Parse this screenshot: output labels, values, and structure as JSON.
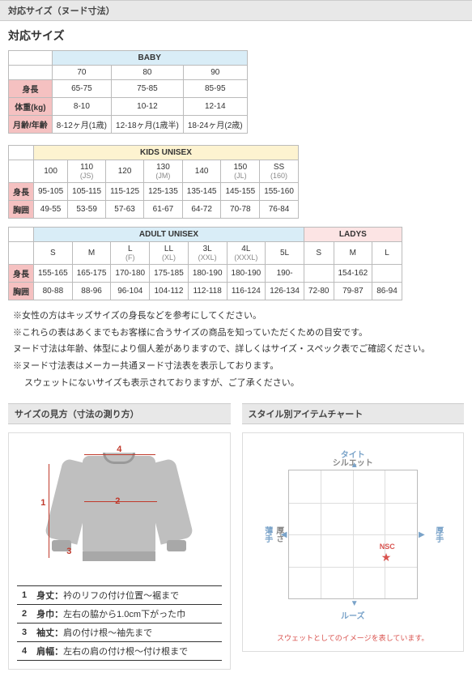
{
  "header": {
    "title": "対応サイズ（ヌード寸法）"
  },
  "main_heading": "対応サイズ",
  "baby": {
    "group": "BABY",
    "sizes": [
      "70",
      "80",
      "90"
    ],
    "rows": {
      "height_label": "身長",
      "height": [
        "65-75",
        "75-85",
        "85-95"
      ],
      "weight_label": "体重(kg)",
      "weight": [
        "8-10",
        "10-12",
        "12-14"
      ],
      "months_label": "月齢/年齢",
      "months": [
        "8-12ヶ月(1歳)",
        "12-18ヶ月(1歳半)",
        "18-24ヶ月(2歳)"
      ]
    }
  },
  "kids": {
    "group": "KIDS UNISEX",
    "sizes": [
      "100",
      "110",
      "120",
      "130",
      "140",
      "150",
      "SS"
    ],
    "subs": [
      "",
      "(JS)",
      "",
      "(JM)",
      "",
      "(JL)",
      "(160)"
    ],
    "rows": {
      "height_label": "身長",
      "height": [
        "95-105",
        "105-115",
        "115-125",
        "125-135",
        "135-145",
        "145-155",
        "155-160"
      ],
      "chest_label": "胸囲",
      "chest": [
        "49-55",
        "53-59",
        "57-63",
        "61-67",
        "64-72",
        "70-78",
        "76-84"
      ]
    }
  },
  "adult": {
    "group": "ADULT UNISEX",
    "sizes": [
      "S",
      "M",
      "L",
      "LL",
      "3L",
      "4L",
      "5L"
    ],
    "subs": [
      "",
      "",
      "(F)",
      "(XL)",
      "(XXL)",
      "(XXXL)",
      ""
    ],
    "rows": {
      "height_label": "身長",
      "height": [
        "155-165",
        "165-175",
        "170-180",
        "175-185",
        "180-190",
        "180-190",
        "190-"
      ],
      "chest_label": "胸囲",
      "chest": [
        "80-88",
        "88-96",
        "96-104",
        "104-112",
        "112-118",
        "116-124",
        "126-134"
      ]
    }
  },
  "ladys": {
    "group": "LADYS",
    "sizes": [
      "S",
      "M",
      "L"
    ],
    "rows": {
      "height_label": "身長",
      "height": [
        "",
        "154-162",
        ""
      ],
      "chest_label": "胸囲",
      "chest": [
        "72-80",
        "79-87",
        "86-94"
      ]
    }
  },
  "notes": [
    "※女性の方はキッズサイズの身長などを参考にしてください。",
    "※これらの表はあくまでもお客様に合うサイズの商品を知っていただくための目安です。",
    "ヌード寸法は年齢、体型により個人差がありますので、詳しくはサイズ・スペック表でご確認ください。",
    "",
    "※ヌード寸法表はメーカー共通ヌード寸法表を表示しております。",
    "スウェットにないサイズも表示されておりますが、ご了承ください。"
  ],
  "left": {
    "title": "サイズの見方（寸法の測り方）",
    "nums": {
      "n1": "1",
      "n2": "2",
      "n3": "3",
      "n4": "4"
    },
    "legend": [
      {
        "n": "1",
        "label": "身丈：",
        "text": "衿のリフの付け位置～裾まで"
      },
      {
        "n": "2",
        "label": "身巾：",
        "text": "左右の脇から1.0cm下がった巾"
      },
      {
        "n": "3",
        "label": "袖丈：",
        "text": "肩の付け根～袖先まで"
      },
      {
        "n": "4",
        "label": "肩幅：",
        "text": "左右の肩の付け根～付け根まで"
      }
    ]
  },
  "right": {
    "title": "スタイル別アイテムチャート",
    "axis": {
      "v": "シルエット",
      "top": "タイト",
      "bottom": "ルーズ",
      "h": "厚さ",
      "left": "薄手",
      "right": "厚手"
    },
    "point": "NSC",
    "star": "★",
    "caption": "スウェットとしてのイメージを表しています。"
  },
  "chart_data": {
    "type": "scatter",
    "title": "スタイル別アイテムチャート",
    "xlabel": "厚さ",
    "ylabel": "シルエット",
    "x_ticks": [
      "薄手",
      "厚手"
    ],
    "y_ticks": [
      "ルーズ",
      "タイト"
    ],
    "xlim": [
      0,
      4
    ],
    "ylim": [
      0,
      4
    ],
    "series": [
      {
        "name": "NSC",
        "values": [
          [
            2.7,
            1.5
          ]
        ]
      }
    ],
    "note": "スウェットとしてのイメージを表しています。"
  }
}
